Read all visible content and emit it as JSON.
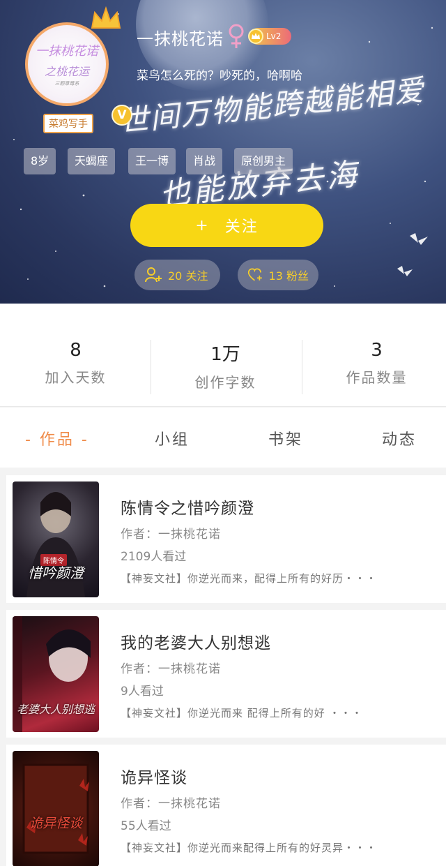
{
  "profile": {
    "username": "一抹桃花诺",
    "level": "Lv2",
    "signature": "菜鸟怎么死的？吵死的，哈啊哈",
    "role_tag": "菜鸡写手",
    "verified_badge": "V",
    "avatar_text": {
      "line1": "一抹桃花诺",
      "line2": "之桃花运",
      "line3": "三颗草莓系"
    },
    "tags": [
      "8岁",
      "天蝎座",
      "王一博",
      "肖战",
      "原创男主"
    ],
    "gender_icon": "female-icon"
  },
  "banner": {
    "line1": "世间万物能跨越能相爱",
    "line2": "也能放弃去海"
  },
  "follow_button": {
    "plus": "+",
    "label": "关注"
  },
  "social": {
    "following_label": "20 关注",
    "fans_label": "13 粉丝"
  },
  "stats": [
    {
      "value": "8",
      "label": "加入天数"
    },
    {
      "value": "1万",
      "label": "创作字数"
    },
    {
      "value": "3",
      "label": "作品数量"
    }
  ],
  "tabs": [
    {
      "label": "- 作品 -",
      "active": true
    },
    {
      "label": "小组",
      "active": false
    },
    {
      "label": "书架",
      "active": false
    },
    {
      "label": "动态",
      "active": false
    }
  ],
  "books": [
    {
      "title": "陈情令之惜吟颜澄",
      "author": "作者：一抹桃花诺",
      "views": "2109人看过",
      "desc": "【神妄文社】你逆光而来，配得上所有的好历・・・",
      "cover_text": "惜吟颜澄",
      "cover_badge": "陈情令"
    },
    {
      "title": "我的老婆大人别想逃",
      "author": "作者：一抹桃花诺",
      "views": "9人看过",
      "desc": "【神妄文社】你逆光而来 配得上所有的好 ・・・",
      "cover_text": "老婆大人别想逃"
    },
    {
      "title": "诡异怪谈",
      "author": "作者：一抹桃花诺",
      "views": "55人看过",
      "desc": "【神妄文社】你逆光而来配得上所有的好灵异・・・",
      "cover_text": "诡异怪谈"
    }
  ],
  "colors": {
    "accent_orange": "#f08c4a",
    "follow_yellow": "#f8d714",
    "stat_yellow": "#f6cd2a"
  }
}
